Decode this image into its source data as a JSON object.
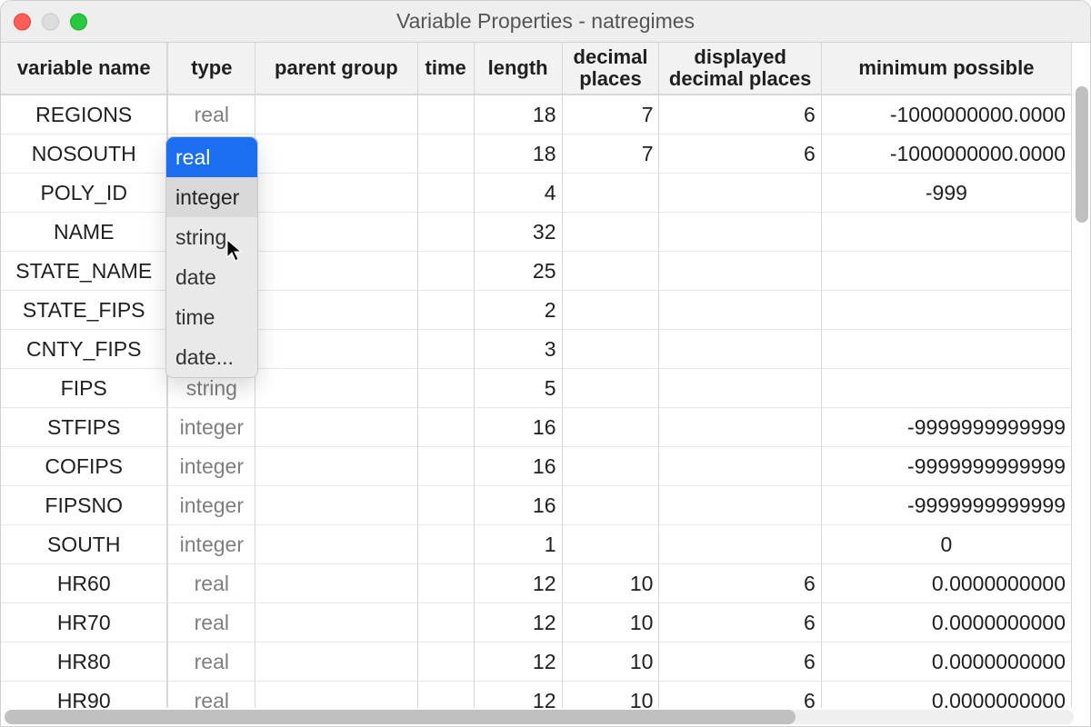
{
  "window": {
    "title": "Variable Properties - natregimes"
  },
  "columns": {
    "variable_name": "variable name",
    "type": "type",
    "parent_group": "parent group",
    "time": "time",
    "length": "length",
    "decimal_places": "decimal places",
    "displayed_decimal_places": "displayed decimal places",
    "minimum_possible": "minimum possible"
  },
  "type_dropdown": {
    "open_row_index": 1,
    "selected": "real",
    "hovered": "integer",
    "options": [
      "real",
      "integer",
      "string",
      "date",
      "time",
      "date..."
    ]
  },
  "rows": [
    {
      "variable_name": "REGIONS",
      "type": "real",
      "parent_group": "",
      "time": "",
      "length": "18",
      "decimal_places": "7",
      "displayed_decimal_places": "6",
      "minimum_possible": "-1000000000.0000"
    },
    {
      "variable_name": "NOSOUTH",
      "type": "",
      "parent_group": "",
      "time": "",
      "length": "18",
      "decimal_places": "7",
      "displayed_decimal_places": "6",
      "minimum_possible": "-1000000000.0000"
    },
    {
      "variable_name": "POLY_ID",
      "type": "",
      "parent_group": "",
      "time": "",
      "length": "4",
      "decimal_places": "",
      "displayed_decimal_places": "",
      "minimum_possible": "-999"
    },
    {
      "variable_name": "NAME",
      "type": "",
      "parent_group": "",
      "time": "",
      "length": "32",
      "decimal_places": "",
      "displayed_decimal_places": "",
      "minimum_possible": ""
    },
    {
      "variable_name": "STATE_NAME",
      "type": "",
      "parent_group": "",
      "time": "",
      "length": "25",
      "decimal_places": "",
      "displayed_decimal_places": "",
      "minimum_possible": ""
    },
    {
      "variable_name": "STATE_FIPS",
      "type": "",
      "parent_group": "",
      "time": "",
      "length": "2",
      "decimal_places": "",
      "displayed_decimal_places": "",
      "minimum_possible": ""
    },
    {
      "variable_name": "CNTY_FIPS",
      "type": "",
      "parent_group": "",
      "time": "",
      "length": "3",
      "decimal_places": "",
      "displayed_decimal_places": "",
      "minimum_possible": ""
    },
    {
      "variable_name": "FIPS",
      "type": "string",
      "parent_group": "",
      "time": "",
      "length": "5",
      "decimal_places": "",
      "displayed_decimal_places": "",
      "minimum_possible": ""
    },
    {
      "variable_name": "STFIPS",
      "type": "integer",
      "parent_group": "",
      "time": "",
      "length": "16",
      "decimal_places": "",
      "displayed_decimal_places": "",
      "minimum_possible": "-9999999999999"
    },
    {
      "variable_name": "COFIPS",
      "type": "integer",
      "parent_group": "",
      "time": "",
      "length": "16",
      "decimal_places": "",
      "displayed_decimal_places": "",
      "minimum_possible": "-9999999999999"
    },
    {
      "variable_name": "FIPSNO",
      "type": "integer",
      "parent_group": "",
      "time": "",
      "length": "16",
      "decimal_places": "",
      "displayed_decimal_places": "",
      "minimum_possible": "-9999999999999"
    },
    {
      "variable_name": "SOUTH",
      "type": "integer",
      "parent_group": "",
      "time": "",
      "length": "1",
      "decimal_places": "",
      "displayed_decimal_places": "",
      "minimum_possible": "0"
    },
    {
      "variable_name": "HR60",
      "type": "real",
      "parent_group": "",
      "time": "",
      "length": "12",
      "decimal_places": "10",
      "displayed_decimal_places": "6",
      "minimum_possible": "0.0000000000"
    },
    {
      "variable_name": "HR70",
      "type": "real",
      "parent_group": "",
      "time": "",
      "length": "12",
      "decimal_places": "10",
      "displayed_decimal_places": "6",
      "minimum_possible": "0.0000000000"
    },
    {
      "variable_name": "HR80",
      "type": "real",
      "parent_group": "",
      "time": "",
      "length": "12",
      "decimal_places": "10",
      "displayed_decimal_places": "6",
      "minimum_possible": "0.0000000000"
    },
    {
      "variable_name": "HR90",
      "type": "real",
      "parent_group": "",
      "time": "",
      "length": "12",
      "decimal_places": "10",
      "displayed_decimal_places": "6",
      "minimum_possible": "0.0000000000"
    }
  ]
}
